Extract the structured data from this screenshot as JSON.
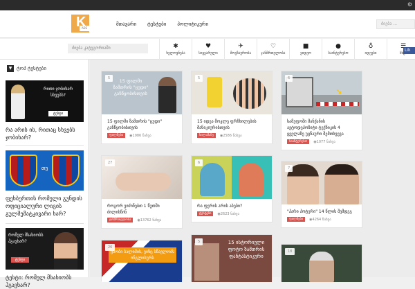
{
  "topbar": {
    "icon": "gear-icon"
  },
  "header": {
    "logo_text": "K",
    "logo_tag": "ADS",
    "nav": [
      "მთავარი",
      "ტესტები",
      "პოლიტიკური"
    ],
    "search_placeholder": "ძიება ..."
  },
  "subheader": {
    "search_placeholder": "ძიება კატეგორიაში",
    "categories": [
      {
        "icon": "sparkle-icon",
        "glyph": "✱",
        "label": "ხელოვნება"
      },
      {
        "icon": "heart-icon",
        "glyph": "♥",
        "label": "სიყვარული"
      },
      {
        "icon": "plane-icon",
        "glyph": "✈",
        "label": "მოგზაურობა"
      },
      {
        "icon": "health-icon",
        "glyph": "♡",
        "label": "ჯანმრთელობა"
      },
      {
        "icon": "video-icon",
        "glyph": "■",
        "label": "ვიდეო"
      },
      {
        "icon": "chat-icon",
        "glyph": "●",
        "label": "საინტერესო"
      },
      {
        "icon": "bulb-icon",
        "glyph": "♁",
        "label": "იდეები"
      },
      {
        "icon": "list-icon",
        "glyph": "☰",
        "label": "სხვა"
      }
    ],
    "fb_label": "Lik"
  },
  "sidebar": {
    "heading": "ტოპ ტესტები",
    "items": [
      {
        "title": "რა არის ის, რითაც სხვებს ჯობიხარ?",
        "img_caption": "ტესტი",
        "img_text": "რითი ჯობიხარ სხვებს?"
      },
      {
        "title": "ფეხბურთის რომელი გუნდის ოფიციალური ლიგის გულშემატკივარი ხარ?",
        "img_caption": "",
        "img_text": "FCB თუ FCB"
      },
      {
        "title": "ტესტი: რომელ მსახიობს ჰგავხარ?",
        "img_caption": "ტესტი",
        "img_text": "რომელ მსახიობს ჰგავხარ?"
      }
    ]
  },
  "cards": [
    {
      "likes": "5",
      "title": "15 ფილმი ზამთრის \"ცუდი\" განწყობისთვის",
      "badge": "ფილმები",
      "views": "1986 ნახვა",
      "img_text": "15 ფილმი ზამთრის \"ცუდი\" განწყობისთვის"
    },
    {
      "likes": "5",
      "title": "15 იდეა მოკლე ფრჩხილების მანიკიურისთვის",
      "badge": "სილამაზე",
      "views": "2586 ნახვა",
      "img_text": ""
    },
    {
      "likes": "6",
      "title": "სამეფოში მანქანის ავტოდეპოზიტი ტექნიკის 4 ყველაზე უცნაური შემთხვევა",
      "badge": "საინტერესო",
      "views": "1077 ნახვა",
      "img_text": ""
    },
    {
      "likes": "27",
      "title": "როგორ ვიძინებთ 1 წუთში ძილისწინ",
      "badge": "ჯანმრთელობა",
      "views": "13762 ნახვა",
      "img_text": ""
    },
    {
      "likes": "6",
      "title": "რა ფერის არის აბები?",
      "badge": "ტესტები",
      "views": "2623 ნახვა",
      "img_text": ""
    },
    {
      "likes": "7",
      "title": "\"ჰარი პოტერი\" 14 წლის შემდეგ",
      "badge": "ფილმები",
      "views": "4264 ნახვა",
      "img_text": ""
    },
    {
      "likes": "26",
      "title": "",
      "badge": "",
      "views": "",
      "img_text": "ცხობი ბალიშის, ვინც სწავლობს ინგლისურს"
    },
    {
      "likes": "5",
      "title": "",
      "badge": "",
      "views": "",
      "img_text": "15 ისტორიული ფოტო ზამთრის ფანტასტიკური"
    },
    {
      "likes": "18",
      "title": "",
      "badge": "",
      "views": "",
      "img_text": ""
    }
  ],
  "colors": {
    "accent": "#d9534f",
    "logo": "#f0a94a",
    "dark": "#2b2b2b"
  }
}
